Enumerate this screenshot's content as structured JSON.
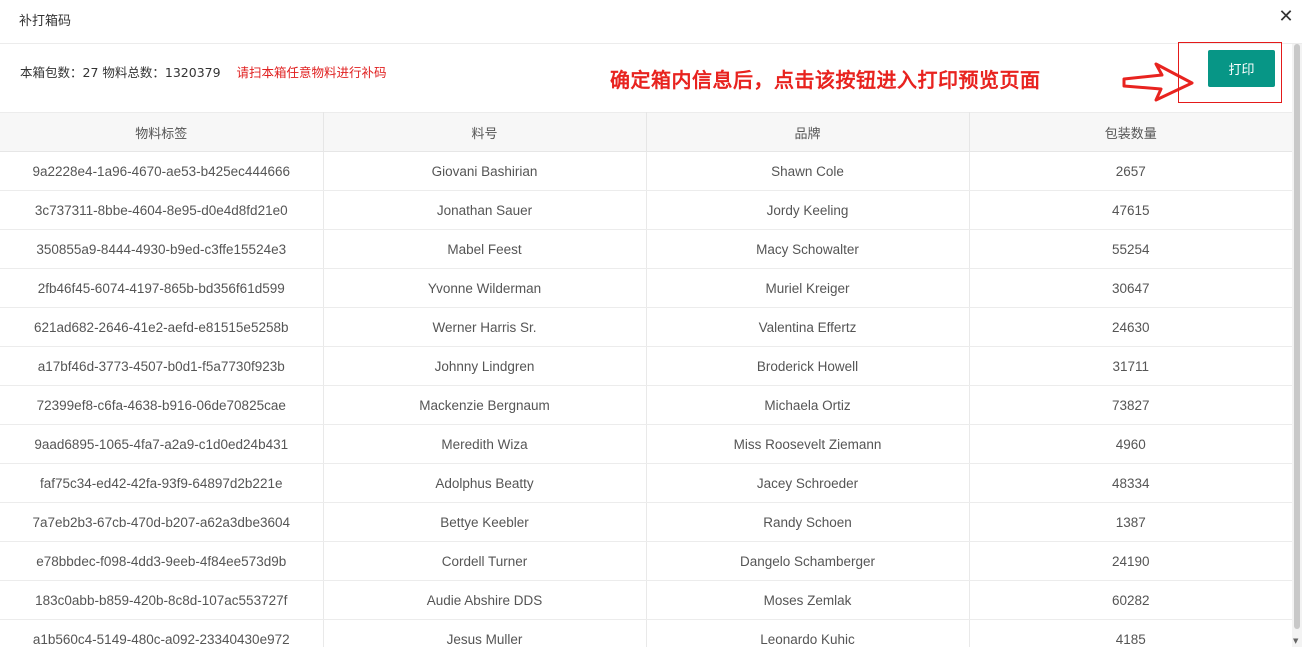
{
  "dialog": {
    "title": "补打箱码",
    "close_glyph": "✕"
  },
  "info": {
    "summary": "本箱包数：27  物料总数：1320379",
    "hint": "请扫本箱任意物料进行补码"
  },
  "annotation": {
    "callout": "确定箱内信息后，点击该按钮进入打印预览页面",
    "highlight_color": "#e41a1a"
  },
  "toolbar": {
    "print_label": "打印",
    "accent": "#079686"
  },
  "table": {
    "columns": [
      "物料标签",
      "料号",
      "品牌",
      "包装数量"
    ],
    "rows": [
      [
        "9a2228e4-1a96-4670-ae53-b425ec444666",
        "Giovani Bashirian",
        "Shawn Cole",
        "2657"
      ],
      [
        "3c737311-8bbe-4604-8e95-d0e4d8fd21e0",
        "Jonathan Sauer",
        "Jordy Keeling",
        "47615"
      ],
      [
        "350855a9-8444-4930-b9ed-c3ffe15524e3",
        "Mabel Feest",
        "Macy Schowalter",
        "55254"
      ],
      [
        "2fb46f45-6074-4197-865b-bd356f61d599",
        "Yvonne Wilderman",
        "Muriel Kreiger",
        "30647"
      ],
      [
        "621ad682-2646-41e2-aefd-e81515e5258b",
        "Werner Harris Sr.",
        "Valentina Effertz",
        "24630"
      ],
      [
        "a17bf46d-3773-4507-b0d1-f5a7730f923b",
        "Johnny Lindgren",
        "Broderick Howell",
        "31711"
      ],
      [
        "72399ef8-c6fa-4638-b916-06de70825cae",
        "Mackenzie Bergnaum",
        "Michaela Ortiz",
        "73827"
      ],
      [
        "9aad6895-1065-4fa7-a2a9-c1d0ed24b431",
        "Meredith Wiza",
        "Miss Roosevelt Ziemann",
        "4960"
      ],
      [
        "faf75c34-ed42-42fa-93f9-64897d2b221e",
        "Adolphus Beatty",
        "Jacey Schroeder",
        "48334"
      ],
      [
        "7a7eb2b3-67cb-470d-b207-a62a3dbe3604",
        "Bettye Keebler",
        "Randy Schoen",
        "1387"
      ],
      [
        "e78bbdec-f098-4dd3-9eeb-4f84ee573d9b",
        "Cordell Turner",
        "Dangelo Schamberger",
        "24190"
      ],
      [
        "183c0abb-b859-420b-8c8d-107ac553727f",
        "Audie Abshire DDS",
        "Moses Zemlak",
        "60282"
      ],
      [
        "a1b560c4-5149-480c-a092-23340430e972",
        "Jesus Muller",
        "Leonardo Kuhic",
        "4185"
      ]
    ]
  }
}
